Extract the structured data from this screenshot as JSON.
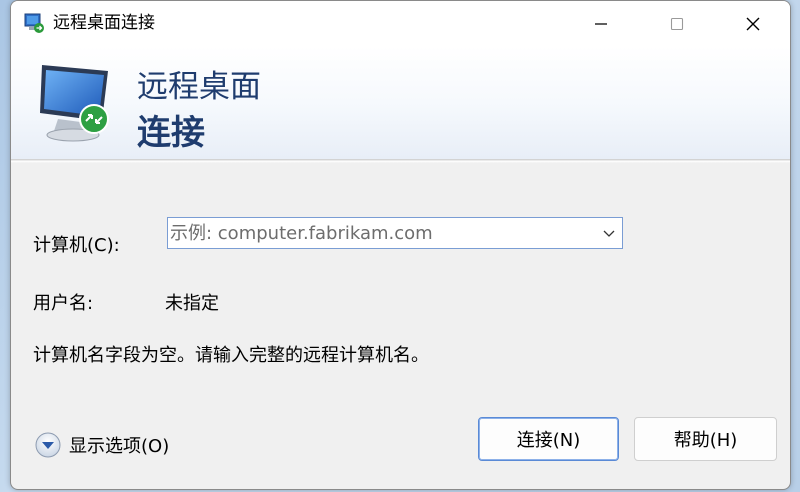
{
  "window": {
    "title": "远程桌面连接"
  },
  "banner": {
    "line1": "远程桌面",
    "line2": "连接"
  },
  "form": {
    "computer_label": "计算机(C):",
    "computer_placeholder": "示例: computer.fabrikam.com",
    "computer_value": "",
    "user_label": "用户名:",
    "user_value": "未指定",
    "status": "计算机名字段为空。请输入完整的远程计算机名。"
  },
  "footer": {
    "options_label": "显示选项(O)",
    "connect_label": "连接(N)",
    "help_label": "帮助(H)"
  },
  "colors": {
    "banner_text": "#1f3c6e",
    "combo_border": "#7a9dd4",
    "default_button_border": "#5a8ad6"
  },
  "icons": {
    "app": "remote-desktop-icon",
    "monitor": "monitor-remote-icon",
    "minimize": "minimize-icon",
    "maximize": "maximize-icon",
    "close": "close-icon",
    "dropdown": "chevron-down-icon",
    "options": "expand-circle-icon"
  }
}
